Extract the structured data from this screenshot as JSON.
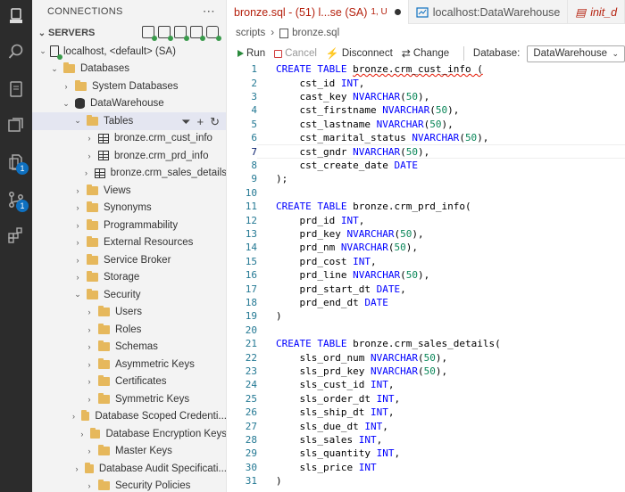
{
  "sidebar": {
    "header": "CONNECTIONS",
    "more_icon": "ellipsis-icon",
    "servers_label": "SERVERS",
    "tree": [
      {
        "label": "localhost, <default> (SA)",
        "icon": "server-icon",
        "depth": 0,
        "chev": "down"
      },
      {
        "label": "Databases",
        "icon": "folder-icon",
        "depth": 1,
        "chev": "down"
      },
      {
        "label": "System Databases",
        "icon": "folder-icon",
        "depth": 2,
        "chev": "right"
      },
      {
        "label": "DataWarehouse",
        "icon": "database-icon",
        "depth": 2,
        "chev": "down"
      },
      {
        "label": "Tables",
        "icon": "folder-icon",
        "depth": 3,
        "chev": "down",
        "selected": true
      },
      {
        "label": "bronze.crm_cust_info",
        "icon": "table-icon",
        "depth": 4,
        "chev": "right"
      },
      {
        "label": "bronze.crm_prd_info",
        "icon": "table-icon",
        "depth": 4,
        "chev": "right"
      },
      {
        "label": "bronze.crm_sales_details",
        "icon": "table-icon",
        "depth": 4,
        "chev": "right"
      },
      {
        "label": "Views",
        "icon": "folder-icon",
        "depth": 3,
        "chev": "right"
      },
      {
        "label": "Synonyms",
        "icon": "folder-icon",
        "depth": 3,
        "chev": "right"
      },
      {
        "label": "Programmability",
        "icon": "folder-icon",
        "depth": 3,
        "chev": "right"
      },
      {
        "label": "External Resources",
        "icon": "folder-icon",
        "depth": 3,
        "chev": "right"
      },
      {
        "label": "Service Broker",
        "icon": "folder-icon",
        "depth": 3,
        "chev": "right"
      },
      {
        "label": "Storage",
        "icon": "folder-icon",
        "depth": 3,
        "chev": "right"
      },
      {
        "label": "Security",
        "icon": "folder-icon",
        "depth": 3,
        "chev": "down"
      },
      {
        "label": "Users",
        "icon": "folder-icon",
        "depth": 4,
        "chev": "right"
      },
      {
        "label": "Roles",
        "icon": "folder-icon",
        "depth": 4,
        "chev": "right"
      },
      {
        "label": "Schemas",
        "icon": "folder-icon",
        "depth": 4,
        "chev": "right"
      },
      {
        "label": "Asymmetric Keys",
        "icon": "folder-icon",
        "depth": 4,
        "chev": "right"
      },
      {
        "label": "Certificates",
        "icon": "folder-icon",
        "depth": 4,
        "chev": "right"
      },
      {
        "label": "Symmetric Keys",
        "icon": "folder-icon",
        "depth": 4,
        "chev": "right"
      },
      {
        "label": "Database Scoped Credenti...",
        "icon": "folder-icon",
        "depth": 4,
        "chev": "right"
      },
      {
        "label": "Database Encryption Keys",
        "icon": "folder-icon",
        "depth": 4,
        "chev": "right"
      },
      {
        "label": "Master Keys",
        "icon": "folder-icon",
        "depth": 4,
        "chev": "right"
      },
      {
        "label": "Database Audit Specificati...",
        "icon": "folder-icon",
        "depth": 4,
        "chev": "right"
      },
      {
        "label": "Security Policies",
        "icon": "folder-icon",
        "depth": 4,
        "chev": "right"
      }
    ]
  },
  "activity_badges": {
    "source_control": "1",
    "extensions": "1"
  },
  "tabs": [
    {
      "label": "bronze.sql - (51) l...se (SA)",
      "status": "1, U"
    },
    {
      "label": "localhost:DataWarehouse"
    },
    {
      "label": "init_d"
    }
  ],
  "breadcrumb": [
    "scripts",
    "bronze.sql"
  ],
  "toolbar": {
    "run": "Run",
    "cancel": "Cancel",
    "disconnect": "Disconnect",
    "change": "Change",
    "database_label": "Database:",
    "database_value": "DataWarehouse"
  },
  "code_lines": [
    "CREATE TABLE bronze.crm_cust_info (",
    "    cst_id INT,",
    "    cast_key NVARCHAR(50),",
    "    cst_firstname NVARCHAR(50),",
    "    cst_lastname NVARCHAR(50),",
    "    cst_marital_status NVARCHAR(50),",
    "    cst_gndr NVARCHAR(50),",
    "    cst_create_date DATE",
    ");",
    "",
    "CREATE TABLE bronze.crm_prd_info(",
    "    prd_id INT,",
    "    prd_key NVARCHAR(50),",
    "    prd_nm NVARCHAR(50),",
    "    prd_cost INT,",
    "    prd_line NVARCHAR(50),",
    "    prd_start_dt DATE,",
    "    prd_end_dt DATE",
    ")",
    "",
    "CREATE TABLE bronze.crm_sales_details(",
    "    sls_ord_num NVARCHAR(50),",
    "    sls_prd_key NVARCHAR(50),",
    "    sls_cust_id INT,",
    "    sls_order_dt INT,",
    "    sls_ship_dt INT,",
    "    sls_due_dt INT,",
    "    sls_sales INT,",
    "    sls_quantity INT,",
    "    sls_price INT",
    ")"
  ],
  "current_line": 7
}
